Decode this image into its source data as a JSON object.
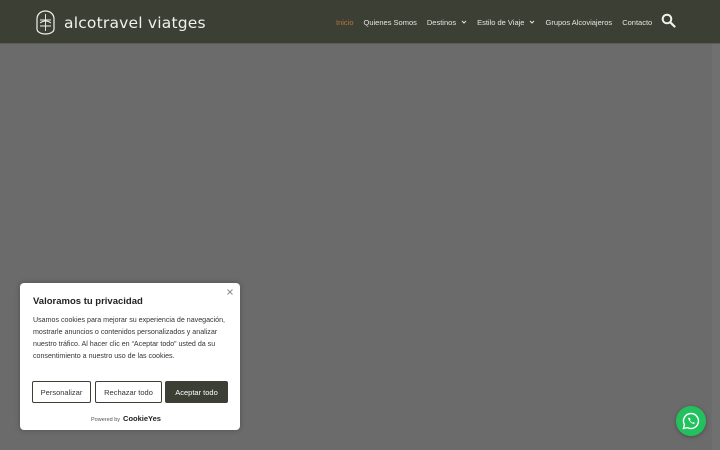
{
  "colors": {
    "header_bg": "#3c3f34",
    "page_overlay": "#6b6b6b",
    "nav_active": "#b8753f",
    "button_dark": "#3c3f34",
    "whatsapp_green": "#22c15e"
  },
  "header": {
    "logo_text": "alcotravel viatges",
    "logo_icon": "compass-badge-icon",
    "nav": [
      {
        "label": "Inicio",
        "active": true
      },
      {
        "label": "Quienes Somos"
      },
      {
        "label": "Destinos",
        "has_dropdown": true
      },
      {
        "label": "Estilo de Viaje",
        "has_dropdown": true
      },
      {
        "label": "Grupos Alcoviajeros"
      },
      {
        "label": "Contacto"
      }
    ],
    "search_icon": "search-icon"
  },
  "cookie_banner": {
    "title": "Valoramos tu privacidad",
    "body": "Usamos cookies para mejorar su experiencia de navegación, mostrarle anuncios o contenidos personalizados y analizar nuestro tráfico. Al hacer clic en “Aceptar todo” usted da su consentimiento a nuestro uso de las cookies.",
    "buttons": {
      "customize": "Personalizar",
      "reject": "Rechazar todo",
      "accept": "Aceptar todo"
    },
    "powered_by": "Powered by",
    "powered_brand": "CookieYes"
  },
  "whatsapp_icon": "whatsapp-icon"
}
